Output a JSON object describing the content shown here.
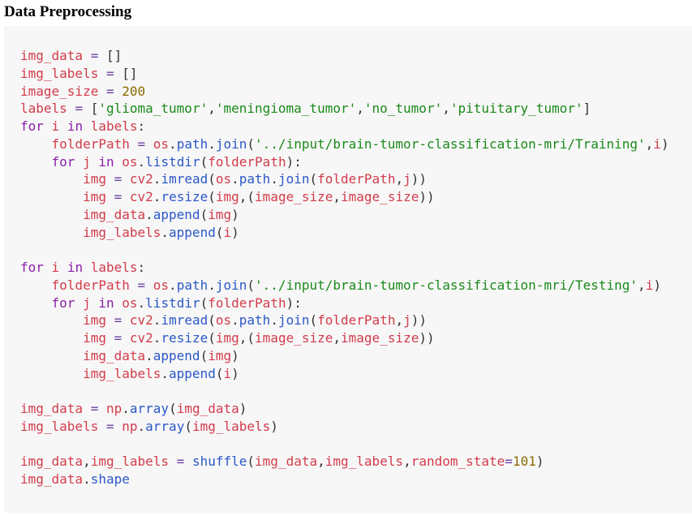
{
  "heading": "Data Preprocessing",
  "code_lines": [
    [
      [
        "var",
        "img_data"
      ],
      [
        "pun",
        " "
      ],
      [
        "op",
        "="
      ],
      [
        "pun",
        " []"
      ]
    ],
    [
      [
        "var",
        "img_labels"
      ],
      [
        "pun",
        " "
      ],
      [
        "op",
        "="
      ],
      [
        "pun",
        " []"
      ]
    ],
    [
      [
        "var",
        "image_size"
      ],
      [
        "pun",
        " "
      ],
      [
        "op",
        "="
      ],
      [
        "pun",
        " "
      ],
      [
        "num",
        "200"
      ]
    ],
    [
      [
        "var",
        "labels"
      ],
      [
        "pun",
        " "
      ],
      [
        "op",
        "="
      ],
      [
        "pun",
        " ["
      ],
      [
        "str",
        "'glioma_tumor'"
      ],
      [
        "pun",
        ","
      ],
      [
        "str",
        "'meningioma_tumor'"
      ],
      [
        "pun",
        ","
      ],
      [
        "str",
        "'no_tumor'"
      ],
      [
        "pun",
        ","
      ],
      [
        "str",
        "'pituitary_tumor'"
      ],
      [
        "pun",
        "]"
      ]
    ],
    [
      [
        "kw",
        "for"
      ],
      [
        "pun",
        " "
      ],
      [
        "var",
        "i"
      ],
      [
        "pun",
        " "
      ],
      [
        "kw",
        "in"
      ],
      [
        "pun",
        " "
      ],
      [
        "var",
        "labels"
      ],
      [
        "pun",
        ":"
      ]
    ],
    [
      [
        "pun",
        "    "
      ],
      [
        "var",
        "folderPath"
      ],
      [
        "pun",
        " "
      ],
      [
        "op",
        "="
      ],
      [
        "pun",
        " "
      ],
      [
        "var",
        "os"
      ],
      [
        "pun",
        "."
      ],
      [
        "fn",
        "path"
      ],
      [
        "pun",
        "."
      ],
      [
        "fn",
        "join"
      ],
      [
        "pun",
        "("
      ],
      [
        "str",
        "'../input/brain-tumor-classification-mri/Training'"
      ],
      [
        "pun",
        ","
      ],
      [
        "var",
        "i"
      ],
      [
        "pun",
        ")"
      ]
    ],
    [
      [
        "pun",
        "    "
      ],
      [
        "kw",
        "for"
      ],
      [
        "pun",
        " "
      ],
      [
        "var",
        "j"
      ],
      [
        "pun",
        " "
      ],
      [
        "kw",
        "in"
      ],
      [
        "pun",
        " "
      ],
      [
        "var",
        "os"
      ],
      [
        "pun",
        "."
      ],
      [
        "fn",
        "listdir"
      ],
      [
        "pun",
        "("
      ],
      [
        "var",
        "folderPath"
      ],
      [
        "pun",
        "):"
      ]
    ],
    [
      [
        "pun",
        "        "
      ],
      [
        "var",
        "img"
      ],
      [
        "pun",
        " "
      ],
      [
        "op",
        "="
      ],
      [
        "pun",
        " "
      ],
      [
        "var",
        "cv2"
      ],
      [
        "pun",
        "."
      ],
      [
        "fn",
        "imread"
      ],
      [
        "pun",
        "("
      ],
      [
        "var",
        "os"
      ],
      [
        "pun",
        "."
      ],
      [
        "fn",
        "path"
      ],
      [
        "pun",
        "."
      ],
      [
        "fn",
        "join"
      ],
      [
        "pun",
        "("
      ],
      [
        "var",
        "folderPath"
      ],
      [
        "pun",
        ","
      ],
      [
        "var",
        "j"
      ],
      [
        "pun",
        "))"
      ]
    ],
    [
      [
        "pun",
        "        "
      ],
      [
        "var",
        "img"
      ],
      [
        "pun",
        " "
      ],
      [
        "op",
        "="
      ],
      [
        "pun",
        " "
      ],
      [
        "var",
        "cv2"
      ],
      [
        "pun",
        "."
      ],
      [
        "fn",
        "resize"
      ],
      [
        "pun",
        "("
      ],
      [
        "var",
        "img"
      ],
      [
        "pun",
        ",("
      ],
      [
        "var",
        "image_size"
      ],
      [
        "pun",
        ","
      ],
      [
        "var",
        "image_size"
      ],
      [
        "pun",
        "))"
      ]
    ],
    [
      [
        "pun",
        "        "
      ],
      [
        "var",
        "img_data"
      ],
      [
        "pun",
        "."
      ],
      [
        "fn",
        "append"
      ],
      [
        "pun",
        "("
      ],
      [
        "var",
        "img"
      ],
      [
        "pun",
        ")"
      ]
    ],
    [
      [
        "pun",
        "        "
      ],
      [
        "var",
        "img_labels"
      ],
      [
        "pun",
        "."
      ],
      [
        "fn",
        "append"
      ],
      [
        "pun",
        "("
      ],
      [
        "var",
        "i"
      ],
      [
        "pun",
        ")"
      ]
    ],
    [],
    [
      [
        "kw",
        "for"
      ],
      [
        "pun",
        " "
      ],
      [
        "var",
        "i"
      ],
      [
        "pun",
        " "
      ],
      [
        "kw",
        "in"
      ],
      [
        "pun",
        " "
      ],
      [
        "var",
        "labels"
      ],
      [
        "pun",
        ":"
      ]
    ],
    [
      [
        "pun",
        "    "
      ],
      [
        "var",
        "folderPath"
      ],
      [
        "pun",
        " "
      ],
      [
        "op",
        "="
      ],
      [
        "pun",
        " "
      ],
      [
        "var",
        "os"
      ],
      [
        "pun",
        "."
      ],
      [
        "fn",
        "path"
      ],
      [
        "pun",
        "."
      ],
      [
        "fn",
        "join"
      ],
      [
        "pun",
        "("
      ],
      [
        "str",
        "'../input/brain-tumor-classification-mri/Testing'"
      ],
      [
        "pun",
        ","
      ],
      [
        "var",
        "i"
      ],
      [
        "pun",
        ")"
      ]
    ],
    [
      [
        "pun",
        "    "
      ],
      [
        "kw",
        "for"
      ],
      [
        "pun",
        " "
      ],
      [
        "var",
        "j"
      ],
      [
        "pun",
        " "
      ],
      [
        "kw",
        "in"
      ],
      [
        "pun",
        " "
      ],
      [
        "var",
        "os"
      ],
      [
        "pun",
        "."
      ],
      [
        "fn",
        "listdir"
      ],
      [
        "pun",
        "("
      ],
      [
        "var",
        "folderPath"
      ],
      [
        "pun",
        "):"
      ]
    ],
    [
      [
        "pun",
        "        "
      ],
      [
        "var",
        "img"
      ],
      [
        "pun",
        " "
      ],
      [
        "op",
        "="
      ],
      [
        "pun",
        " "
      ],
      [
        "var",
        "cv2"
      ],
      [
        "pun",
        "."
      ],
      [
        "fn",
        "imread"
      ],
      [
        "pun",
        "("
      ],
      [
        "var",
        "os"
      ],
      [
        "pun",
        "."
      ],
      [
        "fn",
        "path"
      ],
      [
        "pun",
        "."
      ],
      [
        "fn",
        "join"
      ],
      [
        "pun",
        "("
      ],
      [
        "var",
        "folderPath"
      ],
      [
        "pun",
        ","
      ],
      [
        "var",
        "j"
      ],
      [
        "pun",
        "))"
      ]
    ],
    [
      [
        "pun",
        "        "
      ],
      [
        "var",
        "img"
      ],
      [
        "pun",
        " "
      ],
      [
        "op",
        "="
      ],
      [
        "pun",
        " "
      ],
      [
        "var",
        "cv2"
      ],
      [
        "pun",
        "."
      ],
      [
        "fn",
        "resize"
      ],
      [
        "pun",
        "("
      ],
      [
        "var",
        "img"
      ],
      [
        "pun",
        ",("
      ],
      [
        "var",
        "image_size"
      ],
      [
        "pun",
        ","
      ],
      [
        "var",
        "image_size"
      ],
      [
        "pun",
        "))"
      ]
    ],
    [
      [
        "pun",
        "        "
      ],
      [
        "var",
        "img_data"
      ],
      [
        "pun",
        "."
      ],
      [
        "fn",
        "append"
      ],
      [
        "pun",
        "("
      ],
      [
        "var",
        "img"
      ],
      [
        "pun",
        ")"
      ]
    ],
    [
      [
        "pun",
        "        "
      ],
      [
        "var",
        "img_labels"
      ],
      [
        "pun",
        "."
      ],
      [
        "fn",
        "append"
      ],
      [
        "pun",
        "("
      ],
      [
        "var",
        "i"
      ],
      [
        "pun",
        ")"
      ]
    ],
    [],
    [
      [
        "var",
        "img_data"
      ],
      [
        "pun",
        " "
      ],
      [
        "op",
        "="
      ],
      [
        "pun",
        " "
      ],
      [
        "var",
        "np"
      ],
      [
        "pun",
        "."
      ],
      [
        "fn",
        "array"
      ],
      [
        "pun",
        "("
      ],
      [
        "var",
        "img_data"
      ],
      [
        "pun",
        ")"
      ]
    ],
    [
      [
        "var",
        "img_labels"
      ],
      [
        "pun",
        " "
      ],
      [
        "op",
        "="
      ],
      [
        "pun",
        " "
      ],
      [
        "var",
        "np"
      ],
      [
        "pun",
        "."
      ],
      [
        "fn",
        "array"
      ],
      [
        "pun",
        "("
      ],
      [
        "var",
        "img_labels"
      ],
      [
        "pun",
        ")"
      ]
    ],
    [],
    [
      [
        "var",
        "img_data"
      ],
      [
        "pun",
        ","
      ],
      [
        "var",
        "img_labels"
      ],
      [
        "pun",
        " "
      ],
      [
        "op",
        "="
      ],
      [
        "pun",
        " "
      ],
      [
        "fn",
        "shuffle"
      ],
      [
        "pun",
        "("
      ],
      [
        "var",
        "img_data"
      ],
      [
        "pun",
        ","
      ],
      [
        "var",
        "img_labels"
      ],
      [
        "pun",
        ","
      ],
      [
        "var",
        "random_state"
      ],
      [
        "op",
        "="
      ],
      [
        "num",
        "101"
      ],
      [
        "pun",
        ")"
      ]
    ],
    [
      [
        "var",
        "img_data"
      ],
      [
        "pun",
        "."
      ],
      [
        "fn",
        "shape"
      ]
    ]
  ]
}
